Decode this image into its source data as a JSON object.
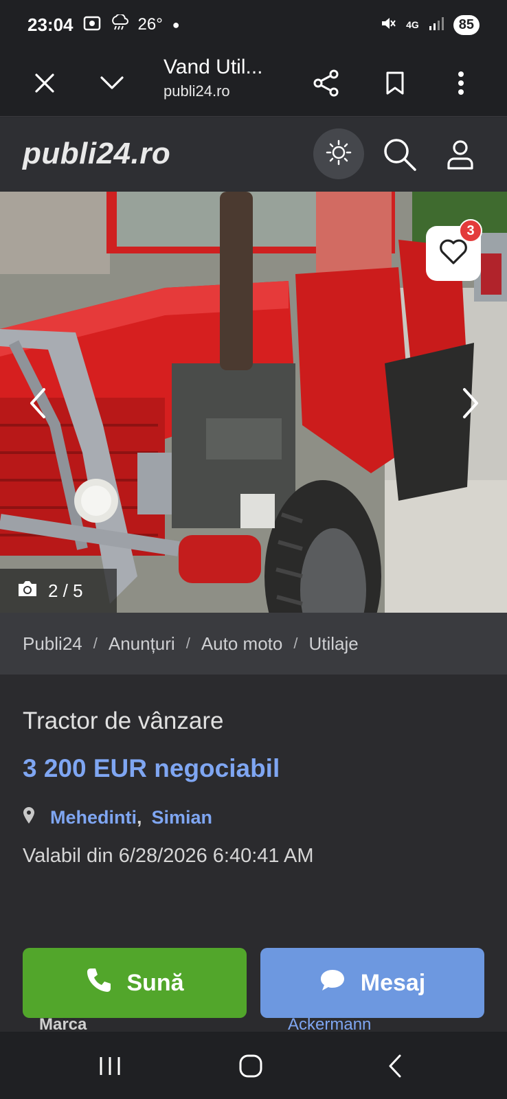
{
  "status_bar": {
    "time": "23:04",
    "temperature": "26°",
    "battery": "85",
    "network": "4G"
  },
  "tab_bar": {
    "page_title": "Vand Util...",
    "domain": "publi24.ro"
  },
  "site_header": {
    "logo": "publi24.ro"
  },
  "gallery": {
    "counter": "2 / 5",
    "favorites_count": "3"
  },
  "breadcrumb": {
    "items": [
      "Publi24",
      "Anunțuri",
      "Auto moto",
      "Utilaje"
    ],
    "separator": "/"
  },
  "listing": {
    "title": "Tractor de vânzare",
    "price": "3 200 EUR negociabil",
    "county": "Mehedinti",
    "city": "Simian",
    "valid_from": "Valabil din 6/28/2026 6:40:41 AM"
  },
  "specs": {
    "key": "Marca",
    "value": "Ackermann"
  },
  "actions": {
    "call_label": "Sună",
    "message_label": "Mesaj"
  },
  "colors": {
    "accent_blue": "#7fa6f2",
    "call_green": "#52a62b",
    "message_blue": "#6d98e0",
    "badge_red": "#e33b3b"
  }
}
